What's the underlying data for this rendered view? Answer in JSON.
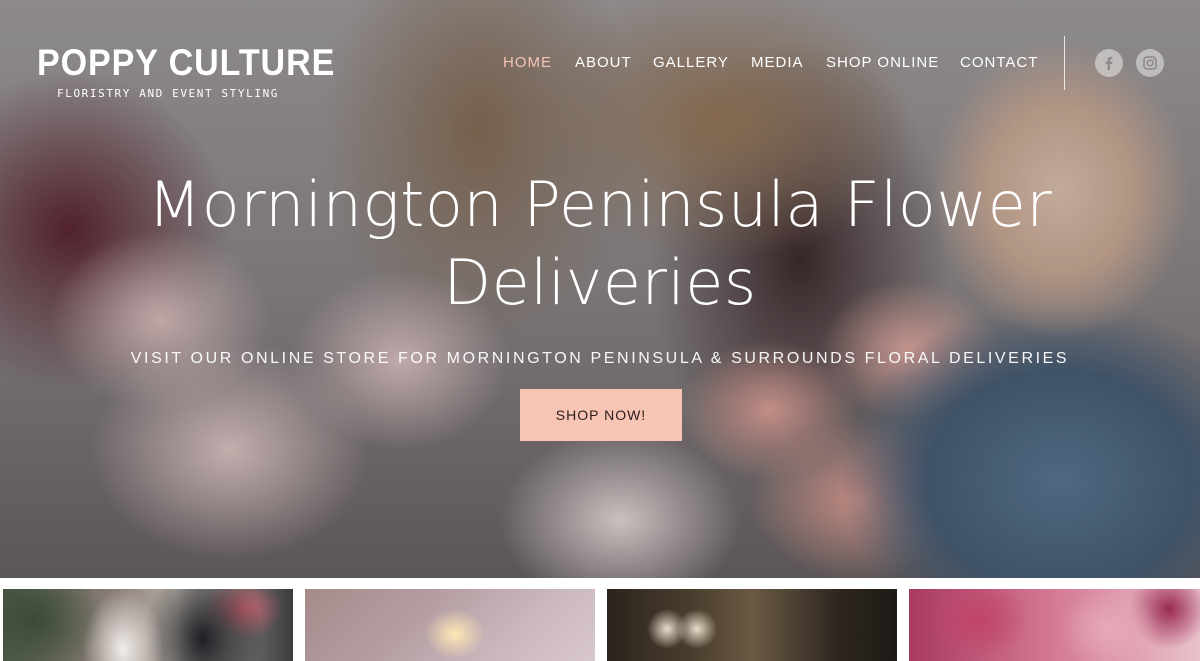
{
  "brand": {
    "title": "POPPY CULTURE",
    "subtitle": "FLORISTRY AND EVENT STYLING"
  },
  "nav": {
    "items": [
      {
        "label": "HOME",
        "active": true
      },
      {
        "label": "ABOUT",
        "active": false
      },
      {
        "label": "GALLERY",
        "active": false
      },
      {
        "label": "MEDIA",
        "active": false
      },
      {
        "label": "SHOP ONLINE",
        "active": false
      },
      {
        "label": "CONTACT",
        "active": false
      }
    ],
    "active_color": "#f6c3b5"
  },
  "social": [
    {
      "icon": "facebook-icon",
      "glyph": "f"
    },
    {
      "icon": "instagram-icon",
      "glyph": ""
    }
  ],
  "hero": {
    "headline_line1": "Mornington Peninsula Flower",
    "headline_line2": "Deliveries",
    "subline": "VISIT OUR ONLINE STORE FOR MORNINGTON PENINSULA & SURROUNDS FLORAL DELIVERIES",
    "cta_label": "SHOP NOW!",
    "cta_color": "#f8c4b4"
  },
  "gallery": {
    "thumbnails": [
      "wedding-couple-photo",
      "hanging-lights-photo",
      "table-setting-photo",
      "pink-flowers-photo"
    ]
  }
}
